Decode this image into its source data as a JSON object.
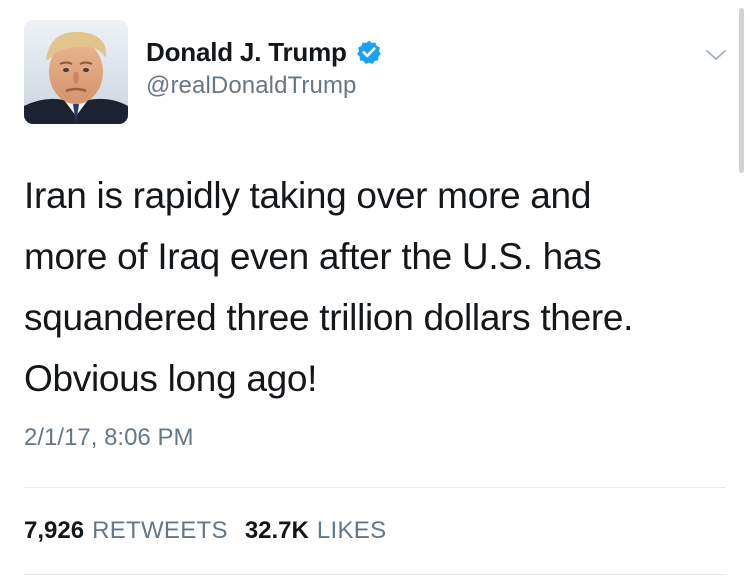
{
  "author": {
    "display_name": "Donald J. Trump",
    "handle": "@realDonaldTrump",
    "verified_icon": "verified-badge-icon",
    "avatar_icon": "profile-avatar"
  },
  "tweet": {
    "lines": [
      "Iran is rapidly taking over more and",
      "more of Iraq even after the U.S. has",
      "squandered three trillion dollars there.",
      "Obvious long ago!"
    ],
    "timestamp": "2/1/17, 8:06 PM"
  },
  "stats": {
    "retweets_count": "7,926",
    "retweets_label": "RETWEETS",
    "likes_count": "32.7K",
    "likes_label": "LIKES"
  },
  "colors": {
    "text_primary": "#14171a",
    "text_secondary": "#657786",
    "verified_blue": "#1da1f2",
    "divider": "#e1e8ed"
  }
}
